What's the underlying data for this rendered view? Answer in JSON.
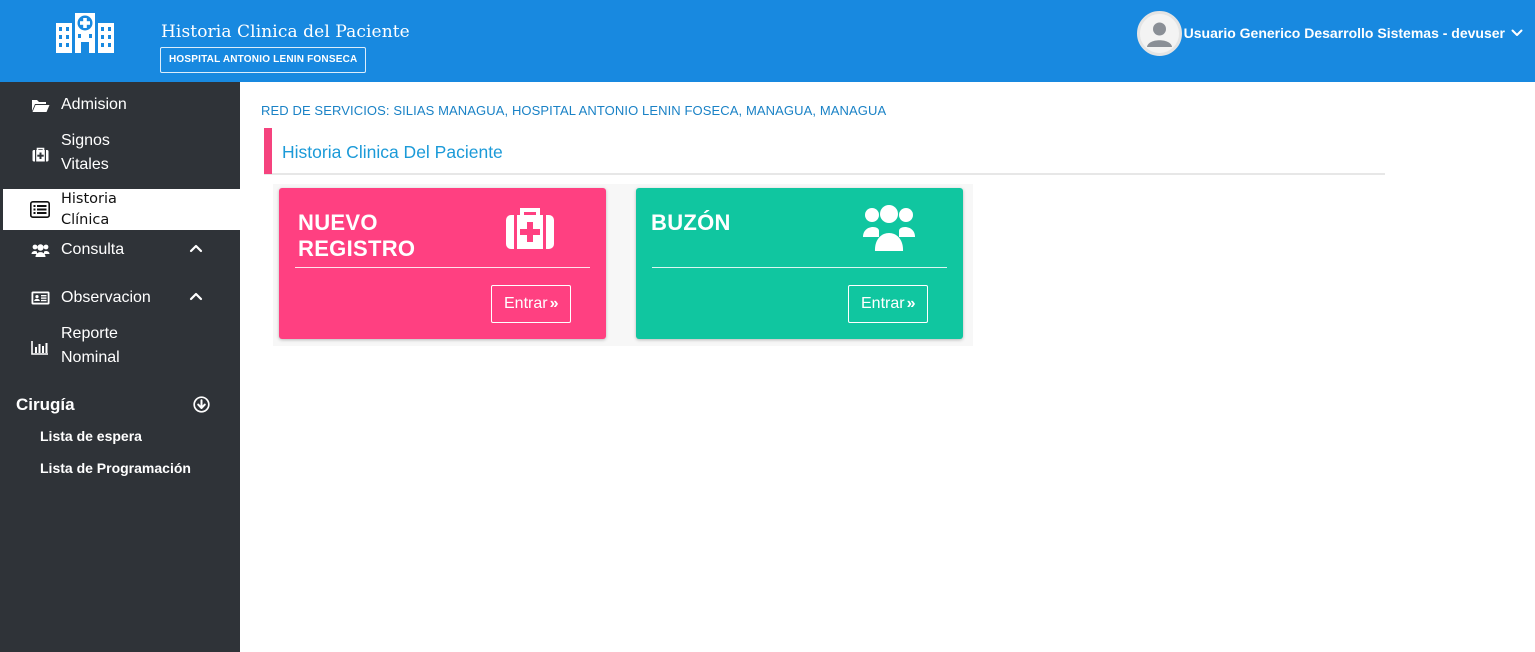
{
  "header": {
    "app_title": "Historia Clinica del Paciente",
    "hospital": "HOSPITAL ANTONIO LENIN FONSECA",
    "user_name": "Usuario Generico Desarrollo Sistemas - devuser"
  },
  "sidebar": {
    "items": [
      {
        "label": "Admision",
        "icon": "folder-open-icon"
      },
      {
        "label_line1": "Signos",
        "label_line2": "Vitales",
        "icon": "medkit-icon"
      },
      {
        "label_line1": "Historia",
        "label_line2": "Clínica",
        "icon": "list-alt-icon",
        "active": true
      },
      {
        "label": "Consulta",
        "icon": "users-icon",
        "expandable": true
      },
      {
        "label": "Observacion",
        "icon": "id-card-icon",
        "expandable": true
      },
      {
        "label_line1": "Reporte",
        "label_line2": "Nominal",
        "icon": "bar-chart-icon"
      }
    ],
    "section": {
      "title": "Cirugía",
      "toggle_icon": "arrow-circle-down-icon",
      "links": [
        "Lista de espera",
        "Lista de Programación"
      ]
    }
  },
  "main": {
    "red_servicios": "RED DE SERVICIOS: SILIAS MANAGUA, HOSPITAL ANTONIO LENIN FOSECA, MANAGUA, MANAGUA",
    "page_title": "Historia Clinica Del Paciente",
    "cards": [
      {
        "title_line1": "NUEVO",
        "title_line2": "REGISTRO",
        "icon": "medkit-icon",
        "button": "Entrar",
        "color": "#ff4081"
      },
      {
        "title_line1": "BUZÓN",
        "title_line2": "",
        "icon": "users-icon",
        "button": "Entrar",
        "color": "#10c6a0"
      }
    ]
  },
  "colors": {
    "topbar": "#1889e0",
    "sidebar": "#2f3338",
    "accent_pink": "#ff4081",
    "accent_teal": "#10c6a0",
    "link_blue": "#1a82c6"
  }
}
